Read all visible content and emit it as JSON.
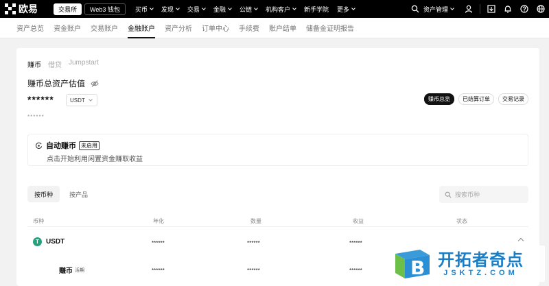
{
  "app": {
    "name": "欧易",
    "mode_tabs": [
      "交易所",
      "Web3 钱包"
    ],
    "active_mode": 0
  },
  "topnav": [
    "买币",
    "发现",
    "交易",
    "金融",
    "公链",
    "机构客户",
    "新手学院",
    "更多"
  ],
  "topnav_caret": [
    true,
    true,
    true,
    true,
    true,
    true,
    false,
    true
  ],
  "top_right": {
    "asset_management": "资产管理",
    "icons": [
      "search-icon",
      "user-icon",
      "download-icon",
      "bell-icon",
      "help-icon",
      "globe-icon"
    ]
  },
  "subnav": {
    "items": [
      "资产总览",
      "资金账户",
      "交易账户",
      "金融账户",
      "资产分析",
      "订单中心",
      "手续费",
      "账户结单",
      "储备金证明报告"
    ],
    "active_index": 3
  },
  "finance": {
    "tabs": [
      "赚币",
      "借贷",
      "Jumpstart"
    ],
    "active_tab": 0,
    "estimate_title": "赚币总资产估值",
    "masked_value": "******",
    "currency": "USDT",
    "sub_masked": "******",
    "buttons": [
      "赚币总览",
      "已结算订单",
      "交易记录"
    ]
  },
  "auto_earn": {
    "title": "自动赚币",
    "badge": "未启用",
    "description": "点击开始利用闲置资金赚取收益"
  },
  "filters": {
    "tabs": [
      "按币种",
      "按产品"
    ],
    "active": 0,
    "search_placeholder": "搜索币种"
  },
  "table": {
    "headers": [
      "币种",
      "年化",
      "数量",
      "收益",
      "状态"
    ],
    "rows": [
      {
        "coin": "USDT",
        "badge": "",
        "apr": "******",
        "amount": "******",
        "earnings": "******"
      },
      {
        "coin": "赚币",
        "badge": "活期",
        "apr": "******",
        "amount": "******",
        "earnings": "******"
      }
    ]
  },
  "watermark": {
    "main": "开拓者奇点",
    "sub": "JSKTZ.COM"
  },
  "colors": {
    "topbar": "#000000",
    "tether": "#26a17b",
    "watermark": "#1b7dc4"
  }
}
